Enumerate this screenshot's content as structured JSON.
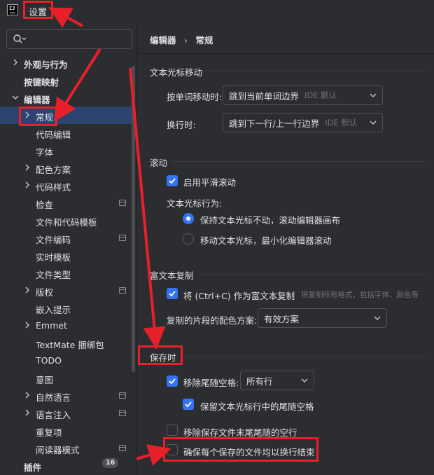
{
  "window": {
    "title": "设置"
  },
  "search": {
    "placeholder": ""
  },
  "tree": [
    {
      "label": "外观与行为",
      "has_chevron": true
    },
    {
      "label": "按键映射",
      "has_chevron": false
    },
    {
      "label": "编辑器",
      "has_chevron": true,
      "expanded": true
    },
    {
      "label": "常规",
      "has_chevron": true,
      "selected": true
    },
    {
      "label": "代码编辑",
      "has_chevron": false
    },
    {
      "label": "字体",
      "has_chevron": false
    },
    {
      "label": "配色方案",
      "has_chevron": true
    },
    {
      "label": "代码样式",
      "has_chevron": true
    },
    {
      "label": "检查",
      "has_chevron": false,
      "sheet_icon": true
    },
    {
      "label": "文件和代码模板",
      "has_chevron": false
    },
    {
      "label": "文件编码",
      "has_chevron": false,
      "sheet_icon": true
    },
    {
      "label": "实时模板",
      "has_chevron": false
    },
    {
      "label": "文件类型",
      "has_chevron": false
    },
    {
      "label": "版权",
      "has_chevron": true,
      "sheet_icon": true
    },
    {
      "label": "嵌入提示",
      "has_chevron": false
    },
    {
      "label": "Emmet",
      "has_chevron": true
    },
    {
      "label": "TextMate 捆绑包",
      "has_chevron": false
    },
    {
      "label": "TODO",
      "has_chevron": false
    },
    {
      "label": "意图",
      "has_chevron": false
    },
    {
      "label": "自然语言",
      "has_chevron": true,
      "sheet_icon": true
    },
    {
      "label": "语言注入",
      "has_chevron": true,
      "sheet_icon": true
    },
    {
      "label": "重复项",
      "has_chevron": false
    },
    {
      "label": "阅读器模式",
      "has_chevron": false,
      "sheet_icon": true
    },
    {
      "label": "插件",
      "has_chevron": false,
      "badge": "16"
    }
  ],
  "breadcrumb": {
    "parent": "编辑器",
    "separator": "›",
    "current": "常规"
  },
  "caret": {
    "section": "文本光标移动",
    "word_move_label": "按单词移动时:",
    "word_move_value": "跳到当前单词边界",
    "word_move_hint": "IDE 默认",
    "line_move_label": "换行时:",
    "line_move_value": "跳到下一行/上一行边界",
    "line_move_hint": "IDE 默认"
  },
  "scroll": {
    "section": "滚动",
    "smooth_label": "启用平滑滚动",
    "smooth_checked": true,
    "behavior_label": "文本光标行为:",
    "option1": "保持文本光标不动，滚动编辑器画布",
    "option2": "移动文本光标，最小化编辑器滚动",
    "selected_option": 1
  },
  "rich_copy": {
    "section": "富文本复制",
    "copy_label": "将 (Ctrl+C) 作为富文本复制",
    "copy_hint": "将复制所有格式，包括字体、颜色等",
    "copy_checked": true,
    "scheme_label": "复制的片段的配色方案:",
    "scheme_value": "有效方案"
  },
  "on_save": {
    "section": "保存时",
    "strip_label": "移除尾随空格:",
    "strip_checked": true,
    "strip_value": "所有行",
    "keep_caret_label": "保留文本光标行中的尾随空格",
    "keep_caret_checked": true,
    "remove_blank_label": "移除保存文件末尾尾随的空行",
    "remove_blank_checked": false,
    "ensure_newline_label": "确保每个保存的文件均以换行结束",
    "ensure_newline_checked": false
  },
  "colors": {
    "accent": "#3574f0",
    "annotation": "#e8202a",
    "selection": "#2e436e"
  }
}
